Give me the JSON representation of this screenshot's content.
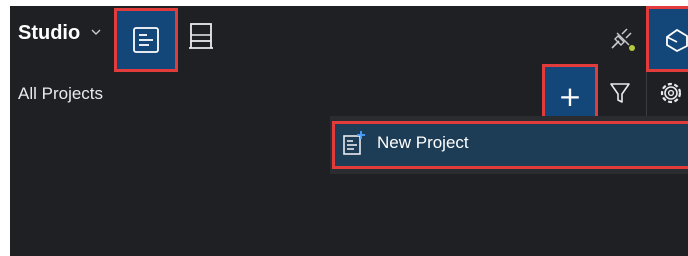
{
  "header": {
    "app_name": "Studio",
    "icons": {
      "app_switcher": "chevron-down-icon",
      "designer": "designer-icon",
      "monitor": "monitor-icon",
      "connection": "plug-icon",
      "hub": "hub-icon"
    }
  },
  "toolbar": {
    "section_title": "All Projects",
    "add_label": "+",
    "filter_icon": "filter-icon",
    "settings_icon": "gear-icon"
  },
  "menu": {
    "items": [
      {
        "label": "New Project",
        "icon": "new-project-icon"
      }
    ]
  },
  "colors": {
    "background": "#1f2023",
    "selected": "#13477a",
    "highlight_box": "#e23b3b",
    "status_dot": "#b5c93a"
  }
}
